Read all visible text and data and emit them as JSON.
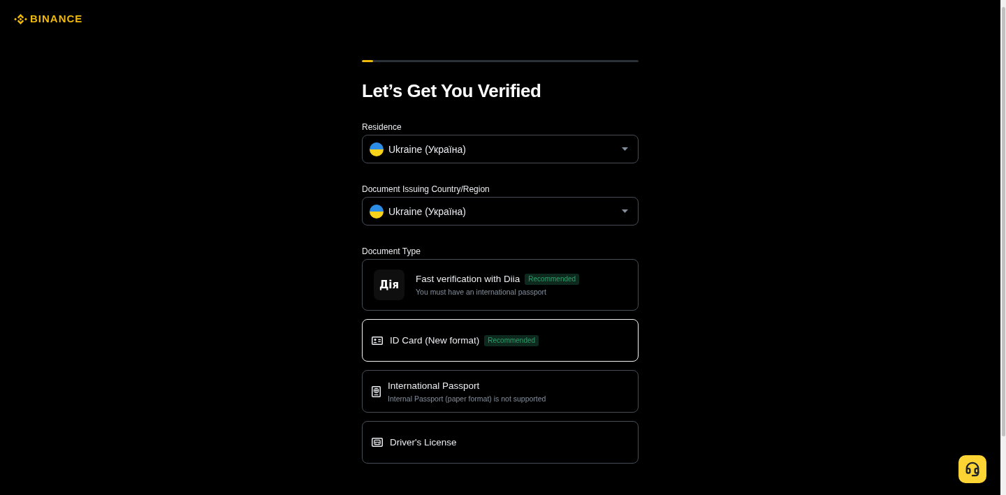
{
  "header": {
    "logo": "BINANCE"
  },
  "progress": {
    "level": 0.04
  },
  "title": "Let’s Get You Verified",
  "fields": [
    {
      "label": "Residence",
      "value": "Ukraine (Україна)"
    },
    {
      "label": "Document Issuing Country/Region",
      "value": "Ukraine (Україна)"
    }
  ],
  "document_type": {
    "label": "Document Type",
    "options": [
      {
        "kind": "app",
        "logo_text": "Дія",
        "title": "Fast verification with Diia",
        "badge": "Recommended",
        "subtitle": "You must have an international passport",
        "selected": false
      },
      {
        "kind": "id_card",
        "title": "ID Card (New format)",
        "badge": "Recommended",
        "selected": true
      },
      {
        "kind": "passport",
        "title": "International Passport",
        "subtitle": "Internal Passport (paper format) is not supported",
        "selected": false
      },
      {
        "kind": "license",
        "title": "Driver's License",
        "selected": false
      }
    ]
  }
}
